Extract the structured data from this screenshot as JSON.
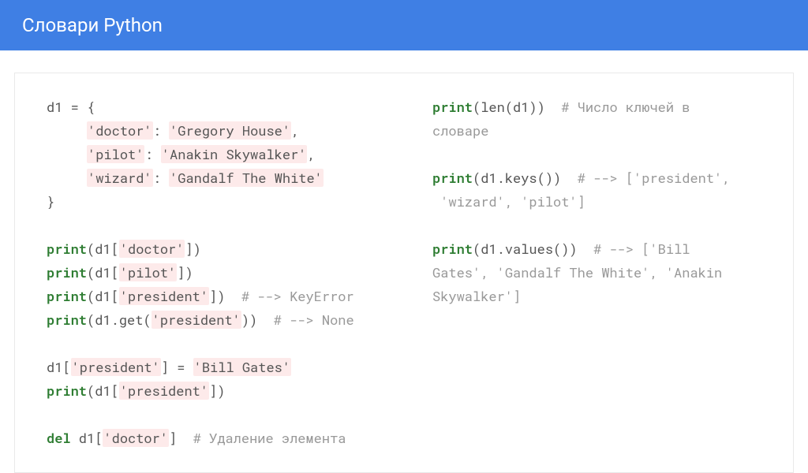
{
  "header": {
    "title": "Словари Python"
  },
  "code": {
    "left": {
      "l1": "d1 = {",
      "l2a": "     ",
      "l2b": "'doctor'",
      "l2c": ": ",
      "l2d": "'Gregory House'",
      "l2e": ",",
      "l3a": "     ",
      "l3b": "'pilot'",
      "l3c": ": ",
      "l3d": "'Anakin Skywalker'",
      "l3e": ",",
      "l4a": "     ",
      "l4b": "'wizard'",
      "l4c": ": ",
      "l4d": "'Gandalf The White'",
      "l5": "}",
      "l7a": "print",
      "l7b": "(d1[",
      "l7c": "'doctor'",
      "l7d": "])",
      "l8a": "print",
      "l8b": "(d1[",
      "l8c": "'pilot'",
      "l8d": "])",
      "l9a": "print",
      "l9b": "(d1[",
      "l9c": "'president'",
      "l9d": "])  ",
      "l9e": "# --> KeyError",
      "l10a": "print",
      "l10b": "(d1.get(",
      "l10c": "'president'",
      "l10d": "))  ",
      "l10e": "# --> None",
      "l12a": "d1[",
      "l12b": "'president'",
      "l12c": "] = ",
      "l12d": "'Bill Gates'",
      "l13a": "print",
      "l13b": "(d1[",
      "l13c": "'president'",
      "l13d": "])",
      "l15a": "del",
      "l15b": " d1[",
      "l15c": "'doctor'",
      "l15d": "]  ",
      "l15e": "# Удаление элемента"
    },
    "right": {
      "l1a": "print",
      "l1b": "(len(d1))  ",
      "l1c": "# Число ключей в",
      "l2": "словаре",
      "l4a": "print",
      "l4b": "(d1.keys())  ",
      "l4c": "# --> ['president',",
      "l5": " 'wizard', 'pilot']",
      "l7a": "print",
      "l7b": "(d1.values())  ",
      "l7c": "# --> ['Bill",
      "l8": "Gates', 'Gandalf The White', 'Anakin",
      "l9": "Skywalker']"
    }
  }
}
